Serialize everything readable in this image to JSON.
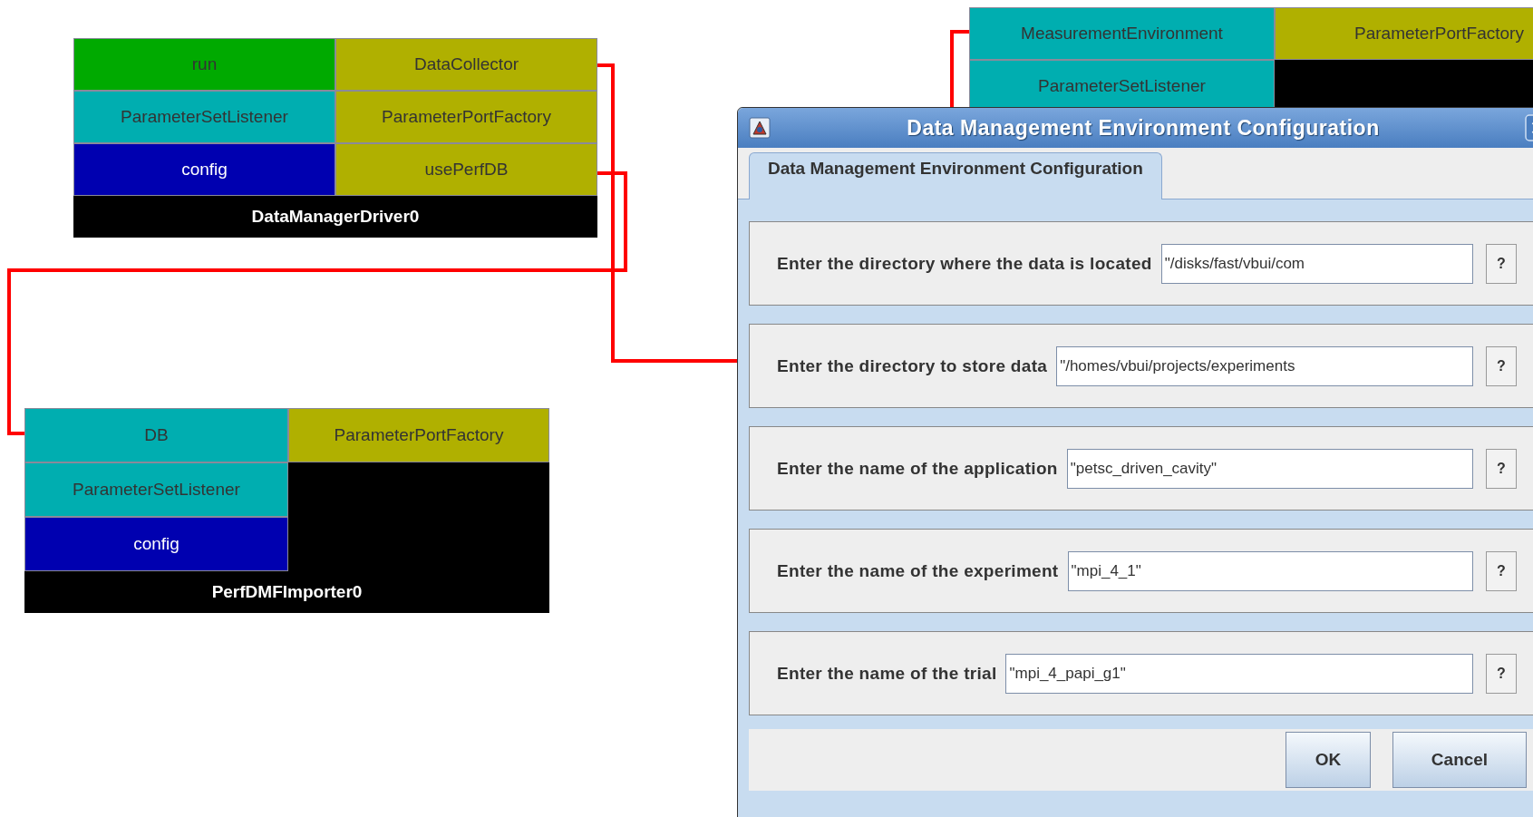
{
  "components": [
    {
      "name": "DataManagerDriver0",
      "left_ports": [
        {
          "label": "run",
          "color": "#00aa00"
        },
        {
          "label": "ParameterSetListener",
          "color": "#00aeb0"
        },
        {
          "label": "config",
          "color": "#0000b0"
        }
      ],
      "right_ports": [
        {
          "label": "DataCollector",
          "color": "#b0b000"
        },
        {
          "label": "ParameterPortFactory",
          "color": "#b0b000"
        },
        {
          "label": "usePerfDB",
          "color": "#b0b000"
        }
      ]
    },
    {
      "name": "PerfDMFImporter0",
      "left_ports": [
        {
          "label": "DB",
          "color": "#00aeb0"
        },
        {
          "label": "ParameterSetListener",
          "color": "#00aeb0"
        },
        {
          "label": "config",
          "color": "#0000b0"
        }
      ],
      "right_ports": [
        {
          "label": "ParameterPortFactory",
          "color": "#b0b000"
        }
      ]
    },
    {
      "left_ports": [
        {
          "label": "MeasurementEnvironment",
          "color": "#00aeb0"
        },
        {
          "label": "ParameterSetListener",
          "color": "#00aeb0"
        }
      ],
      "right_ports": [
        {
          "label": "ParameterPortFactory",
          "color": "#b0b000"
        }
      ]
    }
  ],
  "dialog": {
    "title": "Data Management Environment Configuration",
    "tabs": [
      {
        "label": "Data Management Environment Configuration",
        "selected": true
      }
    ],
    "fields": [
      {
        "label": "Enter the directory where the data is located",
        "value": "\"/disks/fast/vbui/com",
        "help": "?"
      },
      {
        "label": "Enter the directory to store data",
        "value": "\"/homes/vbui/projects/experiments",
        "help": "?"
      },
      {
        "label": "Enter the name of the application",
        "value": "\"petsc_driven_cavity\"",
        "help": "?"
      },
      {
        "label": "Enter the name of the experiment",
        "value": "\"mpi_4_1\"",
        "help": "?"
      },
      {
        "label": "Enter the name of the trial",
        "value": "\"mpi_4_papi_g1\"",
        "help": "?"
      }
    ],
    "buttons": [
      "OK",
      "Cancel"
    ]
  }
}
